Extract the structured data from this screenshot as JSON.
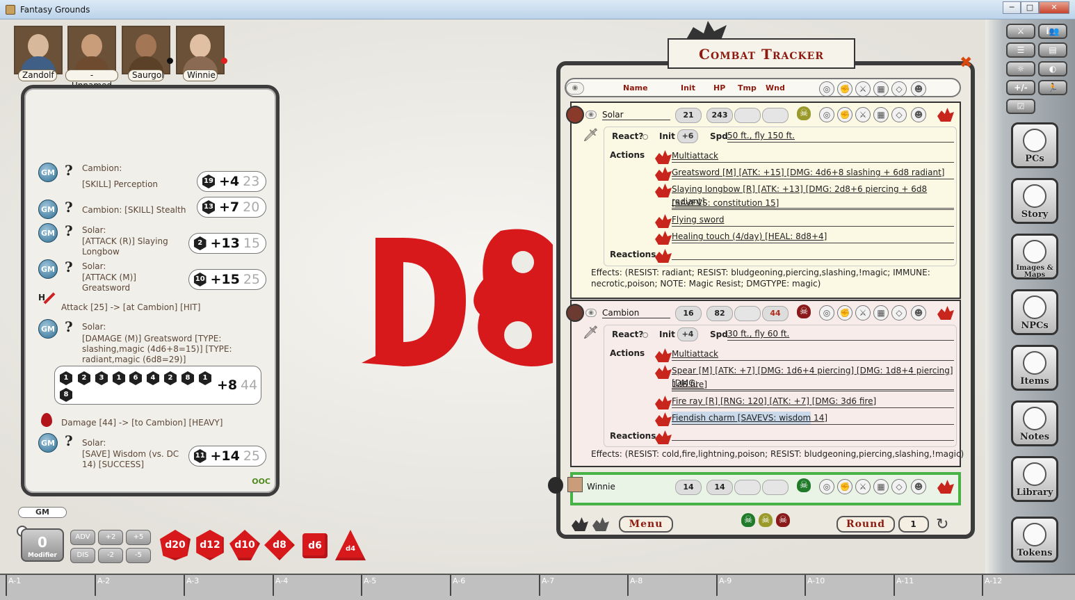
{
  "window": {
    "title": "Fantasy Grounds",
    "btn_min": "─",
    "btn_max": "□",
    "btn_close": "✕"
  },
  "party": [
    {
      "name": "Zandolf"
    },
    {
      "name": "- Unnamed -"
    },
    {
      "name": "Saurgol"
    },
    {
      "name": "Winnie"
    }
  ],
  "chat": {
    "gm_label": "GM",
    "q": "?",
    "entries": [
      {
        "text1": "Cambion:",
        "text2": "[SKILL] Perception",
        "die": "19",
        "mod": "+4",
        "total": "23"
      },
      {
        "text1": "Cambion:   [SKILL] Stealth",
        "die": "13",
        "mod": "+7",
        "total": "20"
      },
      {
        "text1": "Solar:",
        "text2": "[ATTACK (R)] Slaying",
        "text3": "Longbow",
        "die": "2",
        "mod": "+13",
        "total": "15"
      },
      {
        "text1": "Solar:",
        "text2": "[ATTACK (M)]",
        "text3": "Greatsword",
        "die": "10",
        "mod": "+15",
        "total": "25"
      }
    ],
    "attack_icon_label": "H",
    "attack_line": "Attack [25] -> [at Cambion] [HIT]",
    "damage_entry": {
      "text1": "Solar:",
      "text2": "[DAMAGE (M)] Greatsword [TYPE:",
      "text3": "slashing,magic (4d6+8=15)] [TYPE:",
      "text4": "radiant,magic (6d8=29)]"
    },
    "damage_dice": [
      "1",
      "2",
      "3",
      "1",
      "6",
      "4",
      "2",
      "8",
      "1",
      "8"
    ],
    "damage_mod": "+8",
    "damage_total": "44",
    "damage_line": "Damage [44] -> [to Cambion] [HEAVY]",
    "save_entry": {
      "text1": "Solar:",
      "text2": "[SAVE] Wisdom (vs. DC",
      "text3": "14) [SUCCESS]",
      "die": "11",
      "mod": "+14",
      "total": "25"
    },
    "ooc": "OOC"
  },
  "bottom": {
    "gm_tag": "GM",
    "modifier_value": "0",
    "modifier_label": "Modifier",
    "adv": "ADV",
    "dis": "DIS",
    "p2": "+2",
    "p5": "+5",
    "m2": "-2",
    "m5": "-5",
    "dice": [
      "d20",
      "d12",
      "d10",
      "d8",
      "d6",
      "d4"
    ]
  },
  "tracker": {
    "title": "Combat Tracker",
    "close": "✖",
    "headers": {
      "name": "Name",
      "init": "Init",
      "hp": "HP",
      "tmp": "Tmp",
      "wnd": "Wnd"
    },
    "solar": {
      "name": "Solar",
      "init": "21",
      "hp": "243",
      "react": "React?",
      "init_label": "Init",
      "init_mod": "+6",
      "spd_label": "Spd",
      "spd": "50 ft., fly 150 ft.",
      "actions_label": "Actions",
      "reactions_label": "Reactions",
      "actions": [
        "Multiattack",
        "Greatsword [M] [ATK: +15] [DMG: 4d6+8 slashing + 6d8 radiant]",
        "Slaying longbow [R] [ATK: +13] [DMG: 2d8+6 piercing + 6d8 radiant]",
        "[SAVEVS: constitution 15]",
        "Flying sword",
        "Healing touch (4/day) [HEAL: 8d8+4]"
      ],
      "effects1": "Effects: (RESIST: radiant; RESIST: bludgeoning,piercing,slashing,!magic; IMMUNE:",
      "effects2": "necrotic,poison; NOTE: Magic Resist; DMGTYPE: magic)"
    },
    "cambion": {
      "name": "Cambion",
      "init": "16",
      "hp": "82",
      "wnd": "44",
      "react": "React?",
      "init_label": "Init",
      "init_mod": "+4",
      "spd_label": "Spd",
      "spd": "30 ft., fly 60 ft.",
      "actions_label": "Actions",
      "reactions_label": "Reactions",
      "actions": [
        "Multiattack",
        "Spear [M] [ATK: +7] [DMG: 1d6+4 piercing] [DMG: 1d8+4 piercing] [DMG:",
        "1d6 fire]",
        "Fire ray [R] [RNG: 120] [ATK: +7] [DMG: 3d6 fire]",
        "Fiendish charm [SAVEVS: wisdom 14]"
      ],
      "effects": "Effects: (RESIST: cold,fire,lightning,poison; RESIST: bludgeoning,piercing,slashing,!magic)"
    },
    "winnie": {
      "name": "Winnie",
      "init": "14",
      "hp": "14"
    },
    "menu": "Menu",
    "round_label": "Round",
    "round": "1"
  },
  "sidebar": {
    "small": [
      "⚔",
      "i👥",
      "☰",
      "▤",
      "☼",
      "◐",
      "+/-",
      "🏃",
      "☑"
    ],
    "buttons": [
      "PCs",
      "Story",
      "Images & Maps",
      "NPCs",
      "Items",
      "Notes",
      "Library",
      "Tokens"
    ]
  },
  "grid": [
    "A-1",
    "A-2",
    "A-3",
    "A-4",
    "A-5",
    "A-6",
    "A-7",
    "A-8",
    "A-9",
    "A-10",
    "A-11",
    "A-12"
  ],
  "colors": {
    "accent_red": "#d7191c",
    "gold": "#8c1a0f",
    "active_green": "#47b347"
  }
}
